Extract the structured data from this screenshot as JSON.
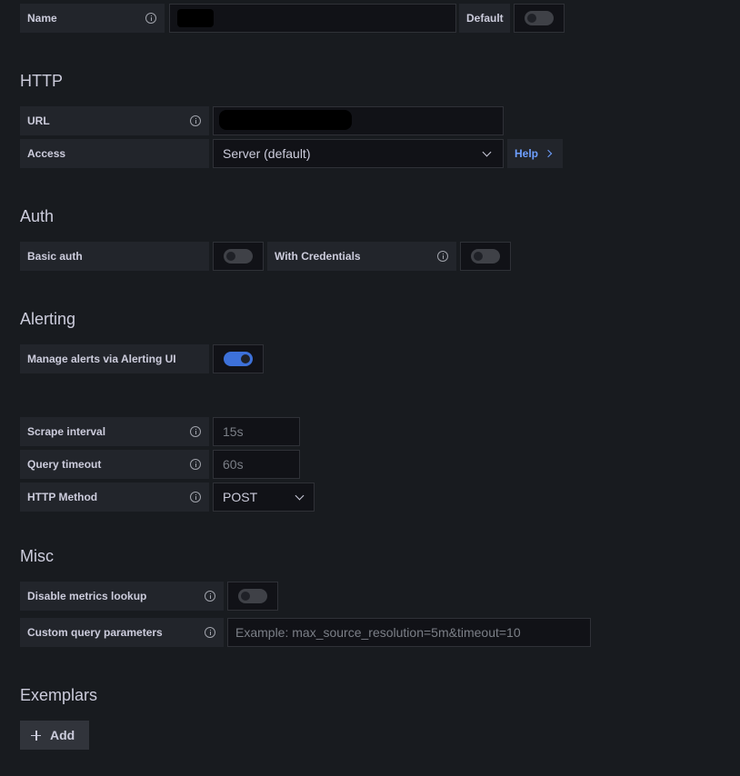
{
  "general": {
    "name_label": "Name",
    "default_label": "Default",
    "default_enabled": false
  },
  "http": {
    "title": "HTTP",
    "url_label": "URL",
    "access_label": "Access",
    "access_value": "Server (default)",
    "help_label": "Help"
  },
  "auth": {
    "title": "Auth",
    "basic_auth_label": "Basic auth",
    "basic_auth_enabled": false,
    "with_credentials_label": "With Credentials",
    "with_credentials_enabled": false
  },
  "alerting": {
    "title": "Alerting",
    "manage_alerts_label": "Manage alerts via Alerting UI",
    "manage_alerts_enabled": true,
    "scrape_interval_label": "Scrape interval",
    "scrape_interval_placeholder": "15s",
    "query_timeout_label": "Query timeout",
    "query_timeout_placeholder": "60s",
    "http_method_label": "HTTP Method",
    "http_method_value": "POST"
  },
  "misc": {
    "title": "Misc",
    "disable_metrics_label": "Disable metrics lookup",
    "disable_metrics_enabled": false,
    "custom_query_label": "Custom query parameters",
    "custom_query_placeholder": "Example: max_source_resolution=5m&timeout=10"
  },
  "exemplars": {
    "title": "Exemplars",
    "add_label": "Add"
  },
  "colors": {
    "background": "#181b1f",
    "label_bg": "#22252b",
    "input_bg": "#111217",
    "accent": "#3d71d9",
    "link": "#6e9fff"
  }
}
